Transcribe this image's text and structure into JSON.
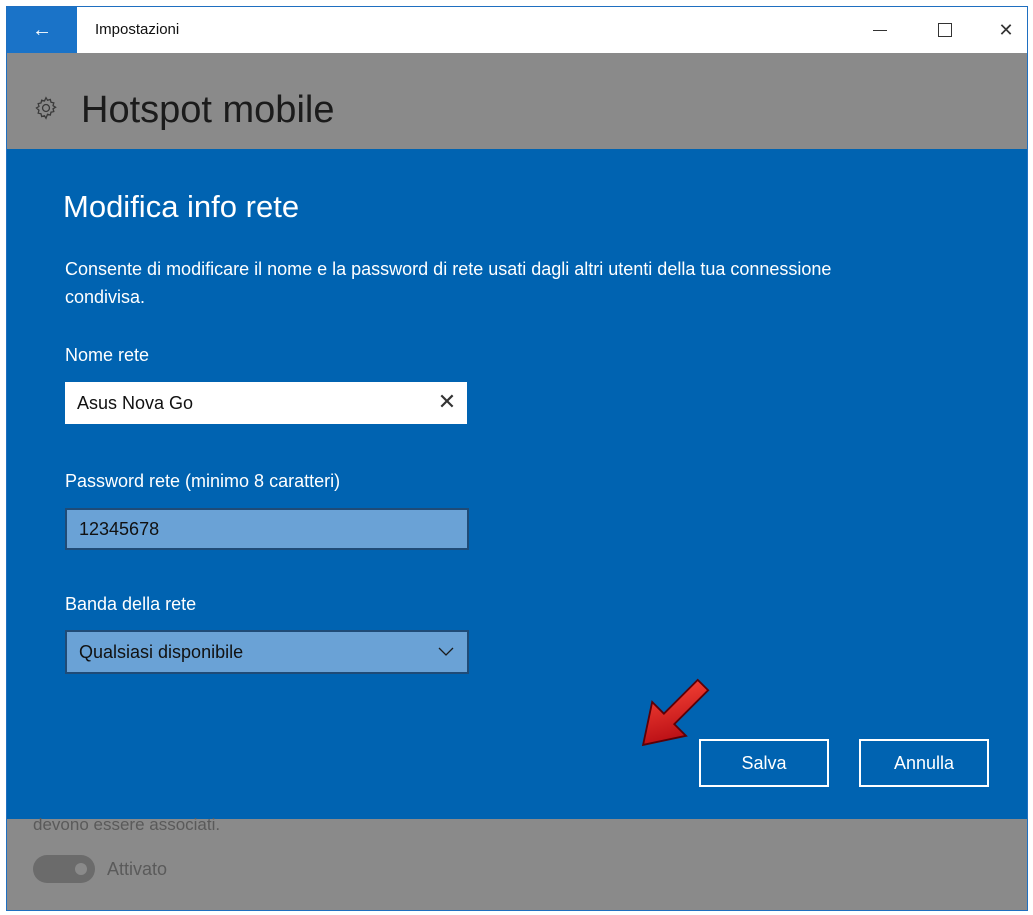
{
  "window": {
    "title": "Impostazioni",
    "back_glyph": "←",
    "close_glyph": "✕"
  },
  "header": {
    "title": "Hotspot mobile",
    "icon": "gear-icon"
  },
  "dialog": {
    "title": "Modifica info rete",
    "description": "Consente di modificare il nome e la password di rete usati dagli altri utenti della tua connessione condivisa.",
    "network_name": {
      "label": "Nome rete",
      "value": "Asus Nova Go",
      "clear_glyph": "✕"
    },
    "password": {
      "label": "Password rete (minimo 8 caratteri)",
      "value": "12345678"
    },
    "band": {
      "label": "Banda della rete",
      "value": "Qualsiasi disponibile"
    },
    "save_label": "Salva",
    "cancel_label": "Annulla"
  },
  "background": {
    "partial_text": "devono essere associati.",
    "toggle_label": "Attivato"
  },
  "colors": {
    "dialog_bg": "#0063b1",
    "accent": "#1a73c8",
    "arrow": "#d0101a"
  }
}
